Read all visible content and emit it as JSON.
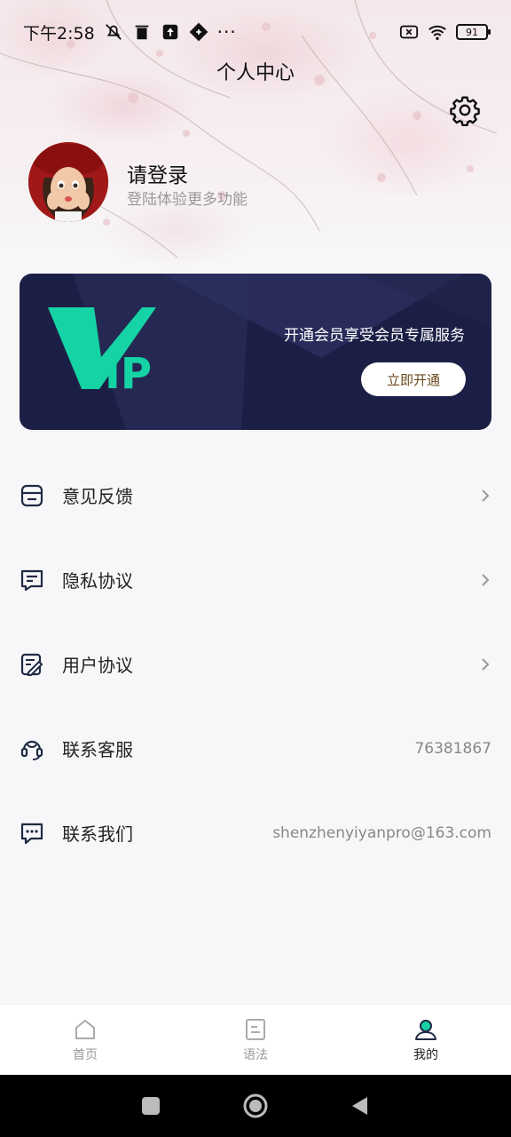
{
  "status_bar": {
    "time": "下午2:58",
    "battery": "91"
  },
  "header": {
    "title": "个人中心"
  },
  "profile": {
    "title": "请登录",
    "subtitle": "登陆体验更多功能"
  },
  "vip": {
    "logo_v": "V",
    "logo_ip": "IP",
    "description": "开通会员享受会员专属服务",
    "button_label": "立即开通",
    "colors": {
      "card": "#1c1f45",
      "logo": "#15d3a4"
    }
  },
  "menu": {
    "items": [
      {
        "label": "意见反馈",
        "icon": "feedback-icon",
        "right": ""
      },
      {
        "label": "隐私协议",
        "icon": "privacy-icon",
        "right": ""
      },
      {
        "label": "用户协议",
        "icon": "agreement-icon",
        "right": ""
      },
      {
        "label": "联系客服",
        "icon": "headset-icon",
        "right": "76381867"
      },
      {
        "label": "联系我们",
        "icon": "chat-icon",
        "right": "shenzhenyiyanpro@163.com"
      }
    ]
  },
  "tabbar": {
    "tabs": [
      {
        "label": "首页",
        "icon": "home-icon"
      },
      {
        "label": "语法",
        "icon": "document-icon"
      },
      {
        "label": "我的",
        "icon": "user-icon"
      }
    ],
    "active_index": 2
  }
}
